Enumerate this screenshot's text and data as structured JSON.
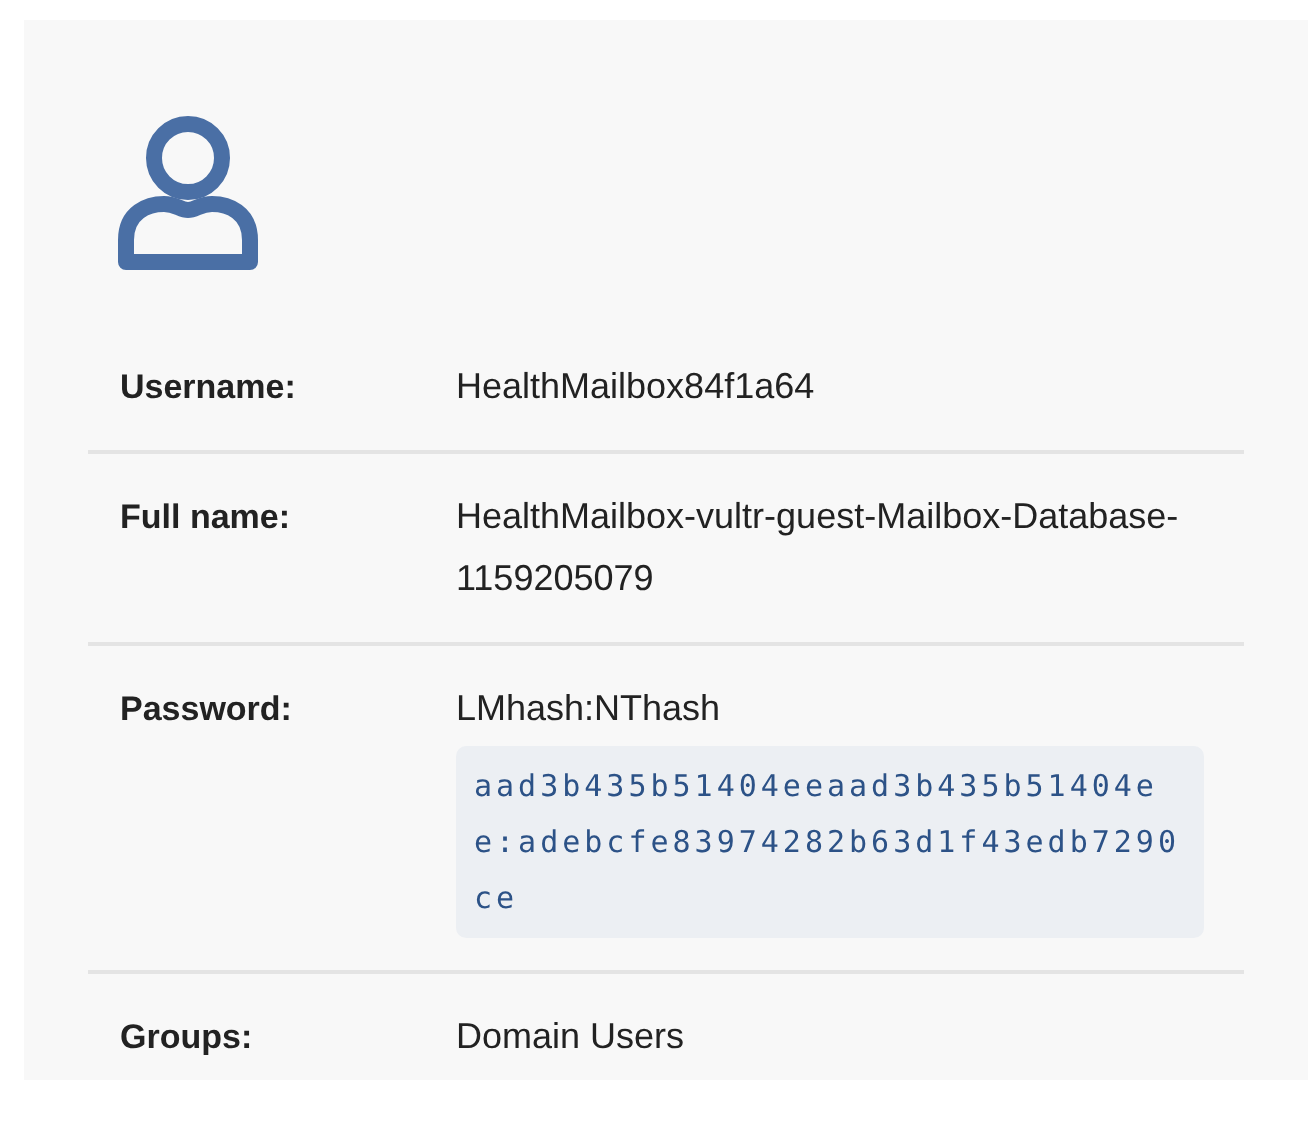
{
  "fields": [
    {
      "label": "Username:",
      "value": "HealthMailbox84f1a64"
    },
    {
      "label": "Full name:",
      "value": "HealthMailbox-vultr-guest-Mailbox-Database-1159205079"
    },
    {
      "label": "Password:",
      "value": "LMhash:NThash",
      "code": "aad3b435b51404eeaad3b435b51404ee:adebcfe83974282b63d1f43edb7290ce"
    },
    {
      "label": "Groups:",
      "value": "Domain Users"
    }
  ]
}
